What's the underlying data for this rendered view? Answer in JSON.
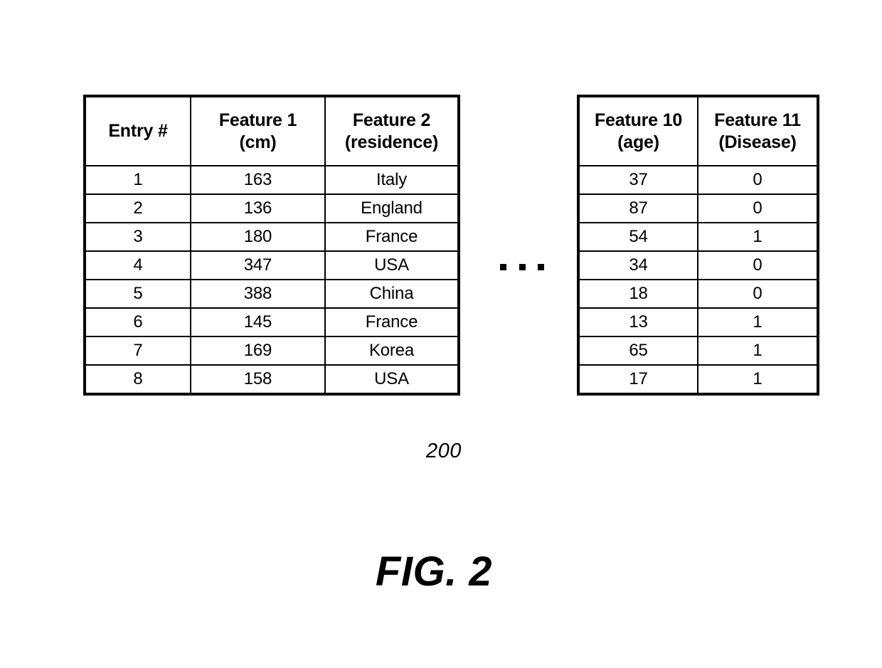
{
  "figure": {
    "caption": "FIG. 2",
    "reference_numeral": "200",
    "ellipsis": "..."
  },
  "table_left": {
    "headers": [
      {
        "line1": "Entry #",
        "line2": ""
      },
      {
        "line1": "Feature 1",
        "line2": "(cm)"
      },
      {
        "line1": "Feature 2",
        "line2": "(residence)"
      }
    ],
    "rows": [
      {
        "entry": "1",
        "feature1": "163",
        "feature2": "Italy"
      },
      {
        "entry": "2",
        "feature1": "136",
        "feature2": "England"
      },
      {
        "entry": "3",
        "feature1": "180",
        "feature2": "France"
      },
      {
        "entry": "4",
        "feature1": "347",
        "feature2": "USA"
      },
      {
        "entry": "5",
        "feature1": "388",
        "feature2": "China"
      },
      {
        "entry": "6",
        "feature1": "145",
        "feature2": "France"
      },
      {
        "entry": "7",
        "feature1": "169",
        "feature2": "Korea"
      },
      {
        "entry": "8",
        "feature1": "158",
        "feature2": "USA"
      }
    ]
  },
  "table_right": {
    "headers": [
      {
        "line1": "Feature 10",
        "line2": "(age)"
      },
      {
        "line1": "Feature 11",
        "line2": "(Disease)"
      }
    ],
    "rows": [
      {
        "feature10": "37",
        "feature11": "0"
      },
      {
        "feature10": "87",
        "feature11": "0"
      },
      {
        "feature10": "54",
        "feature11": "1"
      },
      {
        "feature10": "34",
        "feature11": "0"
      },
      {
        "feature10": "18",
        "feature11": "0"
      },
      {
        "feature10": "13",
        "feature11": "1"
      },
      {
        "feature10": "65",
        "feature11": "1"
      },
      {
        "feature10": "17",
        "feature11": "1"
      }
    ]
  },
  "colors": {
    "ink": "#000000",
    "background": "#ffffff"
  }
}
